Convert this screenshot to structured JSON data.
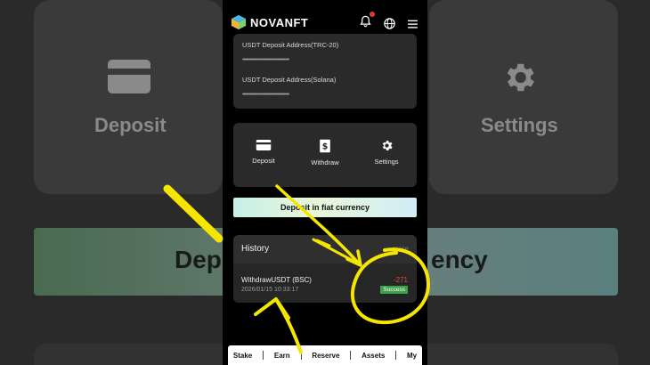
{
  "background": {
    "left_label": "Deposit",
    "right_label": "Settings",
    "banner_left": "Dep",
    "banner_right": "ency"
  },
  "header": {
    "brand": "NOVANFT",
    "has_notification": true
  },
  "deposit_addresses": [
    {
      "label": "USDT Deposit Address(TRC-20)",
      "value": "••••••••••••••••••••••••••••••••••••"
    },
    {
      "label": "USDT Deposit Address(Solana)",
      "value": "••••••••••••••••••••••••••••••••••••"
    }
  ],
  "actions": [
    {
      "label": "Deposit",
      "icon": "card-icon"
    },
    {
      "label": "Withdraw",
      "icon": "withdraw-icon"
    },
    {
      "label": "Settings",
      "icon": "gear-icon"
    }
  ],
  "fiat_button": "Deposit in fiat currency",
  "history": {
    "title": "History",
    "more": "more",
    "transactions": [
      {
        "name": "WithdrawUSDT (BSC)",
        "time": "2026/01/15 10:33:17",
        "amount": "-271",
        "status": "Success"
      }
    ]
  },
  "bottom_nav": [
    "Stake",
    "Earn",
    "Reserve",
    "Assets",
    "My"
  ],
  "colors": {
    "accent_red": "#e34a3c",
    "success_green": "#3aa24a",
    "annotation_yellow": "#f5e600"
  }
}
